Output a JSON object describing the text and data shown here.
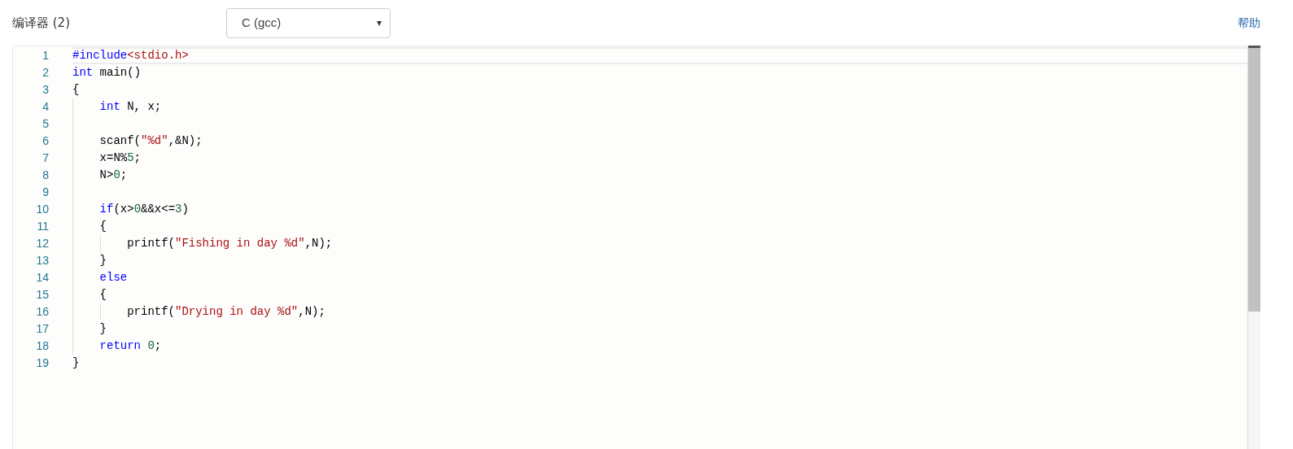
{
  "header": {
    "title": "编译器 (2)",
    "language_select": {
      "value": "C (gcc)",
      "caret": "▾"
    },
    "help_link": "帮助"
  },
  "editor": {
    "lines": [
      {
        "number": "1",
        "active": true,
        "kind": "top",
        "tokens": [
          {
            "kind": "meta",
            "text": "#include"
          },
          {
            "kind": "string",
            "text": "<stdio.h>"
          }
        ]
      },
      {
        "number": "2",
        "active": false,
        "kind": "top",
        "tokens": [
          {
            "kind": "keyword",
            "text": "int"
          },
          {
            "kind": "plain",
            "text": " main()"
          }
        ]
      },
      {
        "number": "3",
        "active": false,
        "kind": "top",
        "tokens": [
          {
            "kind": "plain",
            "text": "{"
          }
        ]
      },
      {
        "number": "4",
        "active": false,
        "kind": "inner",
        "tokens": [
          {
            "kind": "keyword",
            "text": "int"
          },
          {
            "kind": "plain",
            "text": " N, x;"
          }
        ]
      },
      {
        "number": "5",
        "active": false,
        "kind": "inner"
      },
      {
        "number": "6",
        "active": false,
        "kind": "inner",
        "tokens": [
          {
            "kind": "plain",
            "text": "scanf("
          },
          {
            "kind": "string",
            "text": "\"%d\""
          },
          {
            "kind": "plain",
            "text": ",&N);"
          }
        ]
      },
      {
        "number": "7",
        "active": false,
        "kind": "inner",
        "tokens": [
          {
            "kind": "plain",
            "text": "x=N%"
          },
          {
            "kind": "number",
            "text": "5"
          },
          {
            "kind": "plain",
            "text": ";"
          }
        ]
      },
      {
        "number": "8",
        "active": false,
        "kind": "inner",
        "tokens": [
          {
            "kind": "plain",
            "text": "N>"
          },
          {
            "kind": "number",
            "text": "0"
          },
          {
            "kind": "plain",
            "text": ";"
          }
        ]
      },
      {
        "number": "9",
        "active": false,
        "kind": "inner"
      },
      {
        "number": "10",
        "active": false,
        "kind": "inner",
        "tokens": [
          {
            "kind": "keyword",
            "text": "if"
          },
          {
            "kind": "plain",
            "text": "(x>"
          },
          {
            "kind": "number",
            "text": "0"
          },
          {
            "kind": "plain",
            "text": "&&x<="
          },
          {
            "kind": "number",
            "text": "3"
          },
          {
            "kind": "plain",
            "text": ")"
          }
        ]
      },
      {
        "number": "11",
        "active": false,
        "kind": "inner",
        "tokens": [
          {
            "kind": "plain",
            "text": "{"
          }
        ]
      },
      {
        "number": "12",
        "active": false,
        "kind": "deep",
        "tokens": [
          {
            "kind": "plain",
            "text": "printf("
          },
          {
            "kind": "string",
            "text": "\"Fishing in day %d\""
          },
          {
            "kind": "plain",
            "text": ",N);"
          }
        ]
      },
      {
        "number": "13",
        "active": false,
        "kind": "inner",
        "tokens": [
          {
            "kind": "plain",
            "text": "}"
          }
        ]
      },
      {
        "number": "14",
        "active": false,
        "kind": "inner",
        "tokens": [
          {
            "kind": "keyword",
            "text": "else"
          }
        ]
      },
      {
        "number": "15",
        "active": false,
        "kind": "inner",
        "tokens": [
          {
            "kind": "plain",
            "text": "{"
          }
        ]
      },
      {
        "number": "16",
        "active": false,
        "kind": "deep",
        "tokens": [
          {
            "kind": "plain",
            "text": "printf("
          },
          {
            "kind": "string",
            "text": "\"Drying in day %d\""
          },
          {
            "kind": "plain",
            "text": ",N);"
          }
        ]
      },
      {
        "number": "17",
        "active": false,
        "kind": "inner",
        "tokens": [
          {
            "kind": "plain",
            "text": "}"
          }
        ]
      },
      {
        "number": "18",
        "active": false,
        "kind": "inner",
        "tokens": [
          {
            "kind": "keyword",
            "text": "return"
          },
          {
            "kind": "number",
            "text": " 0"
          },
          {
            "kind": "plain",
            "text": ";"
          }
        ]
      },
      {
        "number": "19",
        "active": false,
        "kind": "top",
        "tokens": [
          {
            "kind": "plain",
            "text": "}"
          }
        ]
      }
    ]
  }
}
